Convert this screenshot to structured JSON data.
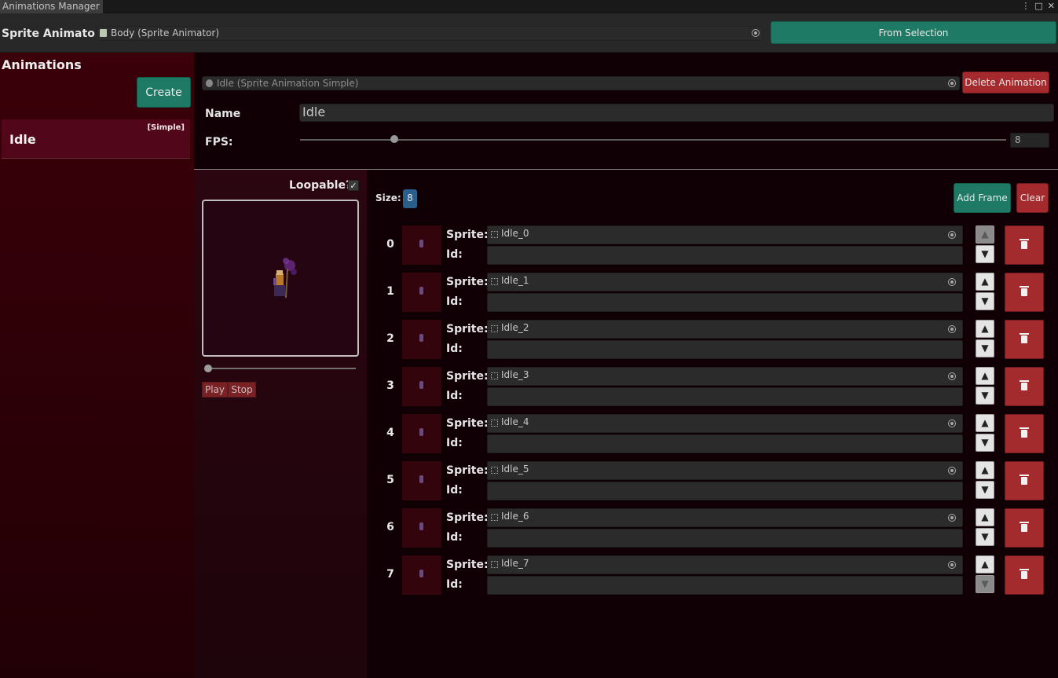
{
  "window": {
    "tab_title": "Animations Manager",
    "menu_icon": "kebab-icon",
    "maximize_icon": "maximize-icon",
    "close_icon": "close-icon"
  },
  "toolbar": {
    "label": "Sprite Animator",
    "animator_field": "Body (Sprite Animator)",
    "from_selection": "From Selection"
  },
  "sidebar": {
    "title": "Animations",
    "create_label": "Create",
    "items": [
      {
        "name": "Idle",
        "tag": "[Simple]"
      }
    ]
  },
  "editor": {
    "animation_field": "Idle (Sprite Animation Simple)",
    "delete_label": "Delete Animation",
    "name_label": "Name",
    "name_value": "Idle",
    "fps_label": "FPS:",
    "fps_value": "8",
    "fps_min": 0,
    "fps_max": 60
  },
  "preview": {
    "loopable_label": "Loopable?",
    "loopable_checked": true,
    "play_label": "Play",
    "stop_label": "Stop",
    "timeline_value": 0
  },
  "frames": {
    "size_label": "Size:",
    "size_value": "8",
    "add_label": "Add Frame",
    "clear_label": "Clear",
    "sprite_label": "Sprite:",
    "id_label": "Id:",
    "up_arrow": "▲",
    "down_arrow": "▼",
    "items": [
      {
        "index": "0",
        "sprite": "Idle_0",
        "id": ""
      },
      {
        "index": "1",
        "sprite": "Idle_1",
        "id": ""
      },
      {
        "index": "2",
        "sprite": "Idle_2",
        "id": ""
      },
      {
        "index": "3",
        "sprite": "Idle_3",
        "id": ""
      },
      {
        "index": "4",
        "sprite": "Idle_4",
        "id": ""
      },
      {
        "index": "5",
        "sprite": "Idle_5",
        "id": ""
      },
      {
        "index": "6",
        "sprite": "Idle_6",
        "id": ""
      },
      {
        "index": "7",
        "sprite": "Idle_7",
        "id": ""
      }
    ]
  },
  "colors": {
    "accent_green": "#1f7a65",
    "danger_red": "#a52a2d",
    "sidebar_bg": "#3b0009",
    "badge_blue": "#2a5e8b"
  }
}
